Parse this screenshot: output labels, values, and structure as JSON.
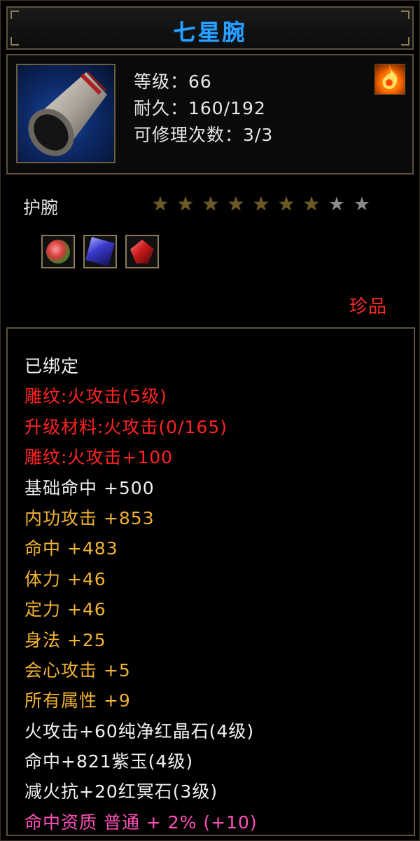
{
  "item": {
    "name": "七星腕",
    "icon": "bracer-icon",
    "level_line": "等级：66",
    "durability_line": "耐久：160/192",
    "repair_line": "可修理次数：3/3",
    "element_icon": "fire-element-icon",
    "type": "护腕",
    "stars": {
      "filled": 7,
      "total": 9
    },
    "gems": [
      "green-red-orb-gem-icon",
      "purple-jade-gem-icon",
      "red-crystal-gem-icon"
    ],
    "quality": "珍品"
  },
  "attributes": [
    {
      "text": "已绑定",
      "color": "white"
    },
    {
      "text": "雕纹:火攻击(5级)",
      "color": "red"
    },
    {
      "text": "升级材料:火攻击(0/165)",
      "color": "red"
    },
    {
      "text": "雕纹:火攻击+100",
      "color": "red"
    },
    {
      "text": "基础命中 +500",
      "color": "white"
    },
    {
      "text": "内功攻击 +853",
      "color": "gold"
    },
    {
      "text": "命中 +483",
      "color": "gold"
    },
    {
      "text": "体力 +46",
      "color": "gold"
    },
    {
      "text": "定力 +46",
      "color": "gold"
    },
    {
      "text": "身法 +25",
      "color": "gold"
    },
    {
      "text": "会心攻击 +5",
      "color": "gold"
    },
    {
      "text": "所有属性 +9",
      "color": "gold"
    },
    {
      "text": "火攻击+60纯净红晶石(4级)",
      "color": "white"
    },
    {
      "text": "命中+821紫玉(4级)",
      "color": "white"
    },
    {
      "text": "减火抗+20红冥石(3级)",
      "color": "white"
    },
    {
      "text": "命中资质 普通 + 2% (+10)",
      "color": "pink"
    }
  ],
  "colors": {
    "title": "#2aa0ff",
    "red": "#ff2323",
    "gold": "#f2b233",
    "pink": "#ff52b8",
    "white": "#f0f0f0"
  }
}
